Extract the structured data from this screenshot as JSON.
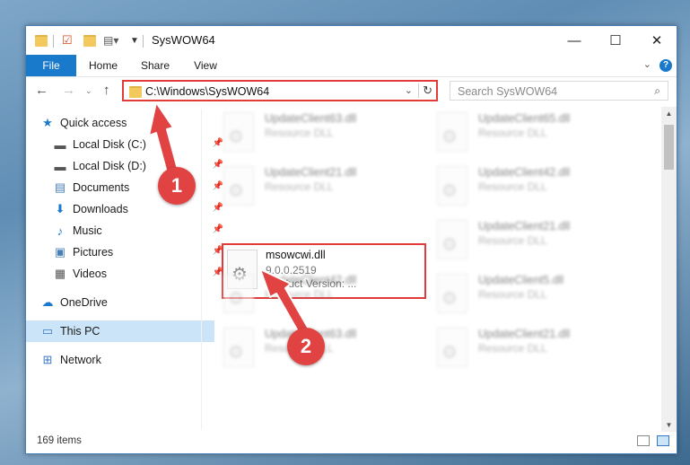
{
  "window": {
    "title": "SysWOW64",
    "minimize_glyph": "—",
    "maximize_glyph": "☐",
    "close_glyph": "✕"
  },
  "ribbon": {
    "tabs": [
      "File",
      "Home",
      "Share",
      "View"
    ],
    "help_glyph": "?",
    "expand_glyph": "⌄"
  },
  "address": {
    "path": "C:\\Windows\\SysWOW64",
    "search_placeholder": "Search SysWOW64"
  },
  "sidebar": {
    "items": [
      {
        "label": "Quick access",
        "icon": "star-icon",
        "glyph": "★",
        "color": "#1979ca",
        "pinned": false
      },
      {
        "label": "Local Disk (C:)",
        "icon": "drive-icon",
        "glyph": "▬",
        "color": "#555555",
        "pinned": true
      },
      {
        "label": "Local Disk (D:)",
        "icon": "drive-icon",
        "glyph": "▬",
        "color": "#555555",
        "pinned": true
      },
      {
        "label": "Documents",
        "icon": "documents-icon",
        "glyph": "▤",
        "color": "#4a7fb5",
        "pinned": true
      },
      {
        "label": "Downloads",
        "icon": "download-icon",
        "glyph": "⬇",
        "color": "#1979ca",
        "pinned": true
      },
      {
        "label": "Music",
        "icon": "music-icon",
        "glyph": "♪",
        "color": "#1979ca",
        "pinned": true
      },
      {
        "label": "Pictures",
        "icon": "pictures-icon",
        "glyph": "▣",
        "color": "#4a7fb5",
        "pinned": true
      },
      {
        "label": "Videos",
        "icon": "videos-icon",
        "glyph": "▦",
        "color": "#555555",
        "pinned": true
      },
      {
        "label": "OneDrive",
        "icon": "cloud-icon",
        "glyph": "☁",
        "color": "#1979ca",
        "pinned": false
      },
      {
        "label": "This PC",
        "icon": "computer-icon",
        "glyph": "▭",
        "color": "#3b78c4",
        "pinned": false
      },
      {
        "label": "Network",
        "icon": "network-icon",
        "glyph": "⊞",
        "color": "#3b78c4",
        "pinned": false
      }
    ]
  },
  "files": {
    "blurred": [
      {
        "name": "UpdateClient63.dll",
        "type": "Resource DLL"
      },
      {
        "name": "UpdateClient65.dll",
        "type": "Resource DLL"
      },
      {
        "name": "UpdateClient21.dll",
        "type": "Resource DLL"
      },
      {
        "name": "UpdateClient42.dll",
        "type": "Resource DLL"
      },
      {
        "name": "UpdateClient21.dll",
        "type": "Resource DLL"
      },
      {
        "name": "UpdateClient42.dll",
        "type": "Resource DLL"
      },
      {
        "name": "UpdateClient5.dll",
        "type": "Resource DLL"
      },
      {
        "name": "UpdateClient63.dll",
        "type": "Resource DLL"
      },
      {
        "name": "UpdateClient21.dll",
        "type": "Resource DLL"
      }
    ],
    "highlighted": {
      "name": "msowcwi.dll",
      "version": "9.0.0.2519",
      "product": "Product Version:    ..."
    }
  },
  "status": {
    "item_count": "169 items"
  },
  "annotations": {
    "badge1": "1",
    "badge2": "2",
    "highlight_color": "#e23b3b"
  }
}
